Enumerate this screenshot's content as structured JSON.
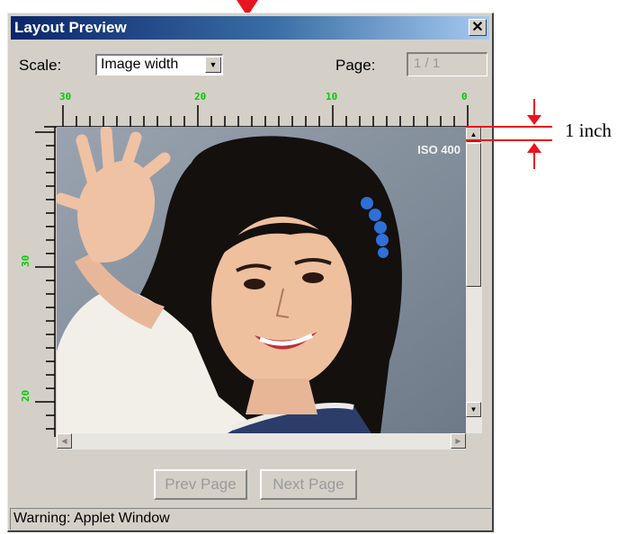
{
  "window": {
    "title": "Layout Preview",
    "close_glyph": "✕"
  },
  "controls": {
    "scale_label": "Scale:",
    "scale_value": "Image width",
    "page_label": "Page:",
    "page_value": "1 / 1"
  },
  "ruler": {
    "top_labels": [
      "30",
      "20",
      "10",
      "0"
    ],
    "left_labels": [
      "30",
      "20"
    ],
    "label_color": "#00cc00"
  },
  "image": {
    "overlay_text": "ISO 400"
  },
  "buttons": {
    "prev": "Prev Page",
    "next": "Next Page"
  },
  "status": {
    "text": "Warning: Applet Window"
  },
  "annotation": {
    "label": "1 inch",
    "color": "#e8141e"
  },
  "icons": {
    "close": "close-icon",
    "dropdown": "chevron-down-icon",
    "scroll_up": "arrow-up-icon",
    "scroll_down": "arrow-down-icon",
    "scroll_left": "arrow-left-icon",
    "scroll_right": "arrow-right-icon"
  }
}
